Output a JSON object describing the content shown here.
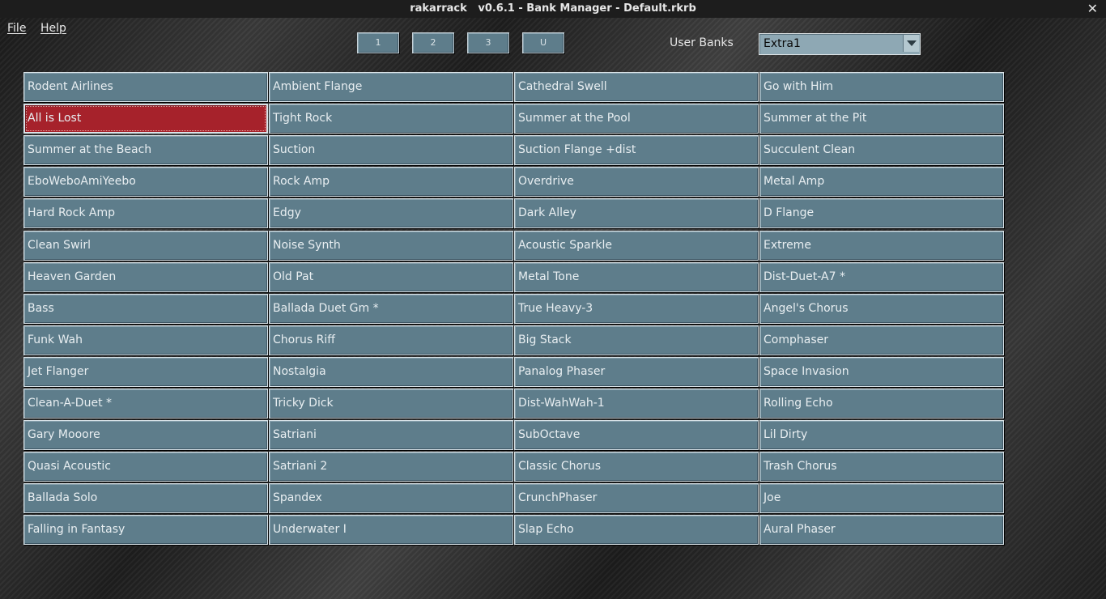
{
  "window": {
    "title": "rakarrack   v0.6.1 - Bank Manager - Default.rkrb",
    "close_glyph": "✕"
  },
  "menu": {
    "file": "File",
    "help": "Help"
  },
  "bank_buttons": [
    "1",
    "2",
    "3",
    "U"
  ],
  "user_banks": {
    "label": "User Banks",
    "selected": "Extra1"
  },
  "presets": {
    "selected_index": 1,
    "columns": [
      [
        "Rodent Airlines",
        "All is Lost",
        "Summer at the Beach",
        "EboWeboAmiYeebo",
        "Hard Rock Amp",
        "Clean Swirl",
        "Heaven Garden",
        "Bass",
        "Funk Wah",
        "Jet Flanger",
        "Clean-A-Duet *",
        "Gary Mooore",
        "Quasi Acoustic",
        "Ballada Solo",
        "Falling in Fantasy"
      ],
      [
        "Ambient Flange",
        "Tight Rock",
        "Suction",
        "Rock Amp",
        "Edgy",
        "Noise Synth",
        "Old Pat",
        "Ballada Duet Gm *",
        "Chorus Riff",
        "Nostalgia",
        "Tricky Dick",
        "Satriani",
        "Satriani 2",
        "Spandex",
        "Underwater I"
      ],
      [
        "Cathedral Swell",
        "Summer at the Pool",
        "Suction Flange +dist",
        "Overdrive",
        "Dark Alley",
        "Acoustic Sparkle",
        "Metal Tone",
        "True Heavy-3",
        "Big Stack",
        "Panalog Phaser",
        "Dist-WahWah-1",
        "SubOctave",
        "Classic Chorus",
        "CrunchPhaser",
        "Slap Echo"
      ],
      [
        "Go with Him",
        "Summer at the Pit",
        "Succulent Clean",
        "Metal Amp",
        "D Flange",
        "Extreme",
        "Dist-Duet-A7 *",
        "Angel's Chorus",
        "Comphaser",
        "Space Invasion",
        "Rolling Echo",
        "Lil Dirty",
        "Trash Chorus",
        "Joe",
        "Aural Phaser"
      ]
    ]
  },
  "colors": {
    "button": "#5e7d8b",
    "selected_button": "#a6222b",
    "select_bg": "#8ea8b4"
  }
}
